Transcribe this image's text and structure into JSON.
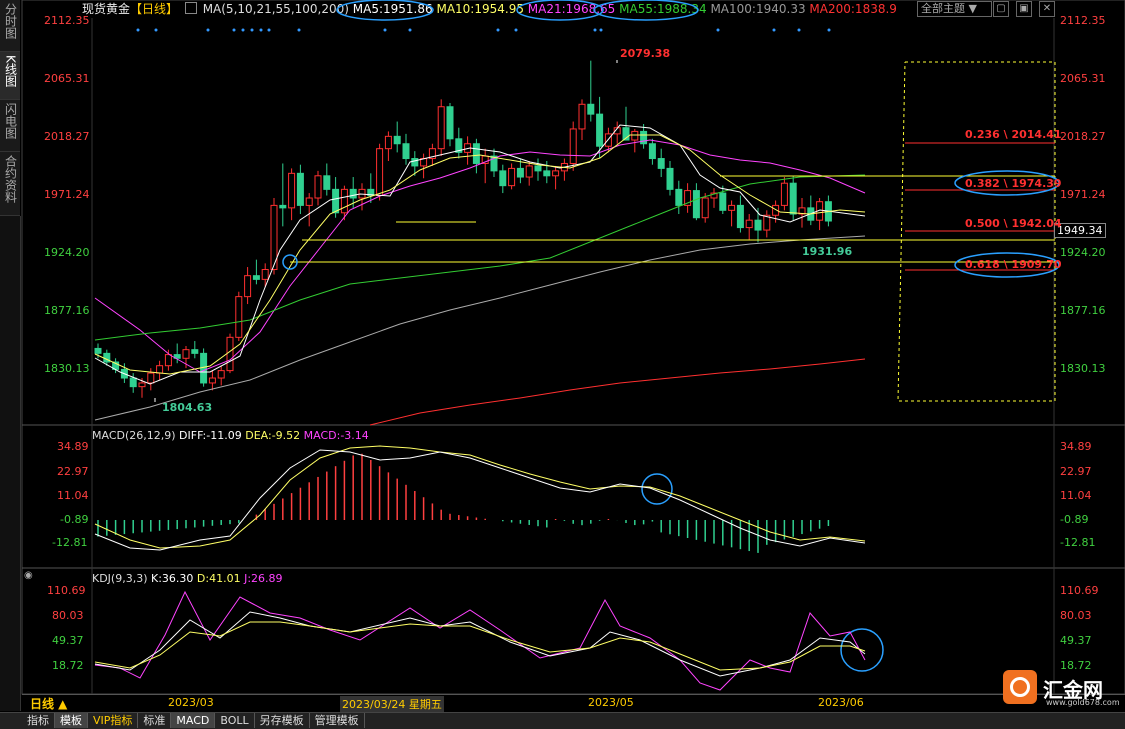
{
  "sidebar": {
    "tabs": [
      "分时图",
      "K线图",
      "闪电图",
      "合约资料"
    ],
    "active": 1
  },
  "header": {
    "title": "现货黄金",
    "period": "【日线】",
    "ma_legend": "MA(5,10,21,55,100,200)",
    "ma5": "MA5:1951.86",
    "ma10": "MA10:1954.95",
    "ma21": "MA21:1968.65",
    "ma55": "MA55:1988.34",
    "ma100": "MA100:1940.33",
    "ma200": "MA200:1838.9",
    "theme_button": "全部主题",
    "colors": {
      "ma5": "#ffffff",
      "ma10": "#ffff66",
      "ma21": "#ff44ff",
      "ma55": "#33cc33",
      "ma100": "#999999",
      "ma200": "#ff3333"
    }
  },
  "main_axis": {
    "ticks": [
      "2112.35",
      "2065.31",
      "2018.27",
      "1971.24",
      "1924.20",
      "1877.16",
      "1830.13"
    ],
    "current_price": "1949.34"
  },
  "annotations": {
    "high": "2079.38",
    "low": "1804.63",
    "recent_low": "1931.96"
  },
  "fibonacci": [
    {
      "label": "0.236 \\ 2014.41",
      "value": 2014.41
    },
    {
      "label": "0.382 \\ 1974.39",
      "value": 1974.39
    },
    {
      "label": "0.500 \\ 1942.04",
      "value": 1942.04
    },
    {
      "label": "0.618 \\ 1909.70",
      "value": 1909.7
    }
  ],
  "macd": {
    "legend": "MACD(26,12,9)",
    "diff": "DIFF:-11.09",
    "dea": "DEA:-9.52",
    "macd": "MACD:-3.14",
    "ticks": [
      "34.89",
      "22.97",
      "11.04",
      "-0.89",
      "-12.81"
    ]
  },
  "kdj": {
    "legend": "KDJ(9,3,3)",
    "k": "K:36.30",
    "d": "D:41.01",
    "j": "J:26.89",
    "ticks": [
      "110.69",
      "80.03",
      "49.37",
      "18.72"
    ]
  },
  "x_axis": {
    "period_button": "日线 ▲",
    "labels": [
      "2023/03",
      "2023/03/24 星期五",
      "2023/05",
      "2023/06"
    ]
  },
  "bottom_tabs": [
    "指标",
    "模板",
    "VIP指标",
    "标准",
    "MACD",
    "BOLL",
    "另存模板",
    "管理模板"
  ],
  "watermark": {
    "brand": "汇金网",
    "url": "www.gold678.com"
  },
  "chart_data": {
    "type": "candlestick",
    "title": "现货黄金【日线】",
    "ylim": [
      1800,
      2115
    ],
    "annotated_values": {
      "high": 2079.38,
      "low": 1804.63,
      "recent_low": 1931.96,
      "last": 1949.34
    },
    "moving_averages": {
      "MA5": 1951.86,
      "MA10": 1954.95,
      "MA21": 1968.65,
      "MA55": 1988.34,
      "MA100": 1940.33,
      "MA200": 1838.9
    },
    "fibonacci_levels": {
      "0.236": 2014.41,
      "0.382": 1974.39,
      "0.500": 1942.04,
      "0.618": 1909.7
    },
    "macd": {
      "DIFF": -11.09,
      "DEA": -9.52,
      "MACD": -3.14
    },
    "kdj": {
      "K": 36.3,
      "D": 41.01,
      "J": 26.89
    }
  }
}
